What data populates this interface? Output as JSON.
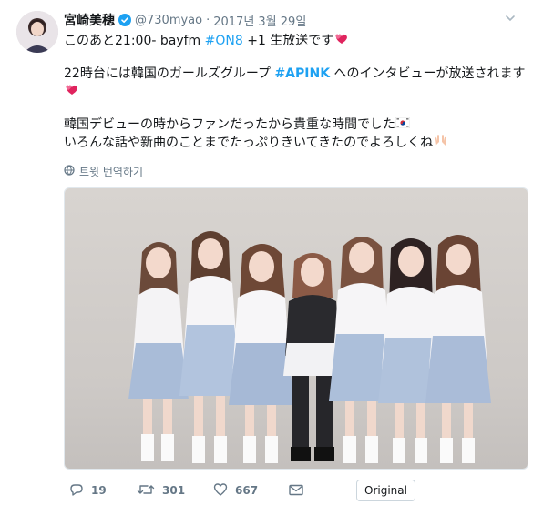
{
  "tweet": {
    "author_name": "宮崎美穂",
    "handle": "@730myao",
    "separator": "·",
    "date": "2017년 3월 29일",
    "lines": {
      "l1_pre": "このあと21:00- bayfm ",
      "l1_tag": "#ON8",
      "l1_post": " +1 生放送です",
      "l2_pre": "22時台には韓国のガールズグループ ",
      "l2_tag": "#APINK",
      "l2_post": " へのインタビューが放送されます",
      "l4": "韓国デビューの時からファンだったから貴重な時間でした",
      "l5": "いろんな話や新曲のことまでたっぷりきいてきたのでよろしくね"
    },
    "translate_label": "트윗 번역하기",
    "photo_alt": "Apink members group photo",
    "actions": {
      "reply_count": "19",
      "retweet_count": "301",
      "like_count": "667",
      "original_label": "Original"
    },
    "colors": {
      "link": "#1da1f2",
      "muted": "#657786",
      "heart": "#e0245e",
      "verified": "#1da1f2"
    }
  }
}
